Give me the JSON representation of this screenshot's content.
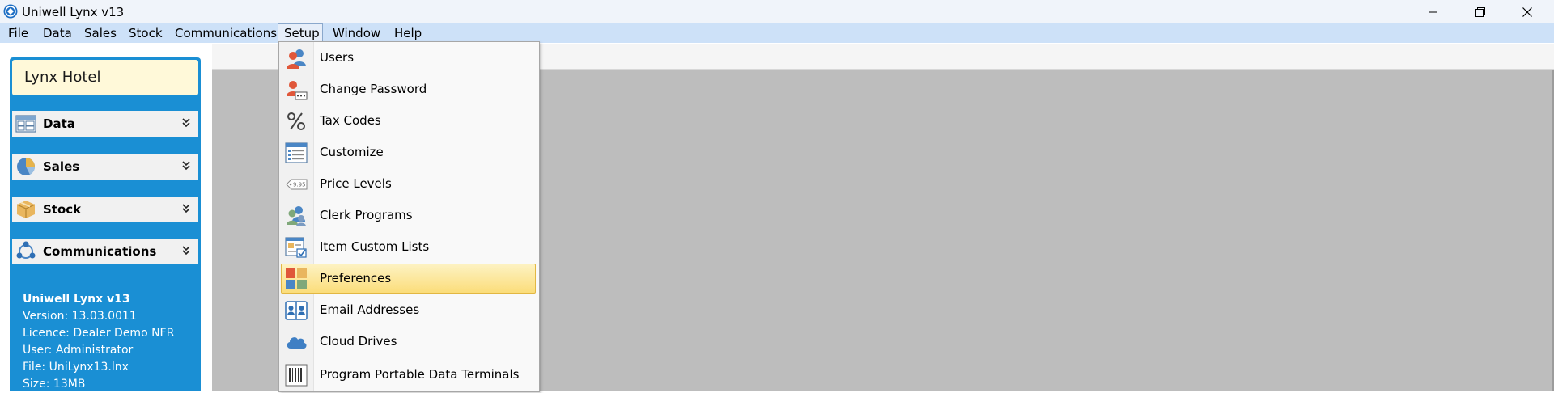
{
  "window": {
    "title": "Uniwell Lynx v13",
    "controls": [
      "minimize",
      "restore",
      "close"
    ]
  },
  "menubar": {
    "items": [
      "File",
      "Data",
      "Sales",
      "Stock",
      "Communications",
      "Setup",
      "Window",
      "Help"
    ],
    "active": "Setup"
  },
  "sidebar": {
    "header": "Lynx Hotel",
    "sections": [
      {
        "label": "Data",
        "icon": "data-icon"
      },
      {
        "label": "Sales",
        "icon": "sales-pie-icon"
      },
      {
        "label": "Stock",
        "icon": "stock-box-icon"
      },
      {
        "label": "Communications",
        "icon": "communications-icon"
      }
    ],
    "info": {
      "product": "Uniwell Lynx v13",
      "version": "Version: 13.03.0011",
      "licence": "Licence: Dealer Demo NFR",
      "user": "User: Administrator",
      "file": "File: UniLynx13.lnx",
      "size": "Size: 13MB"
    }
  },
  "setup_menu": {
    "items": [
      {
        "label": "Users",
        "icon": "users-icon"
      },
      {
        "label": "Change Password",
        "icon": "change-password-icon"
      },
      {
        "label": "Tax Codes",
        "icon": "percent-icon"
      },
      {
        "label": "Customize",
        "icon": "customize-list-icon"
      },
      {
        "label": "Price Levels",
        "icon": "price-tag-icon",
        "tag_text": "9.95"
      },
      {
        "label": "Clerk Programs",
        "icon": "clerk-programs-icon"
      },
      {
        "label": "Item Custom Lists",
        "icon": "item-custom-lists-icon"
      },
      {
        "label": "Preferences",
        "icon": "preferences-tiles-icon"
      },
      {
        "label": "Email Addresses",
        "icon": "email-addresses-icon"
      },
      {
        "label": "Cloud Drives",
        "icon": "cloud-icon"
      },
      {
        "label": "Program Portable Data Terminals",
        "icon": "barcode-icon"
      }
    ],
    "highlighted": "Preferences"
  },
  "colors": {
    "menubar_bg": "#cde1f8",
    "sidebar_blue": "#1a8fd4",
    "hotel_box_bg": "#fff9d9",
    "workspace_gray": "#bdbdbd",
    "highlight_gold": "#fbdd7a"
  }
}
